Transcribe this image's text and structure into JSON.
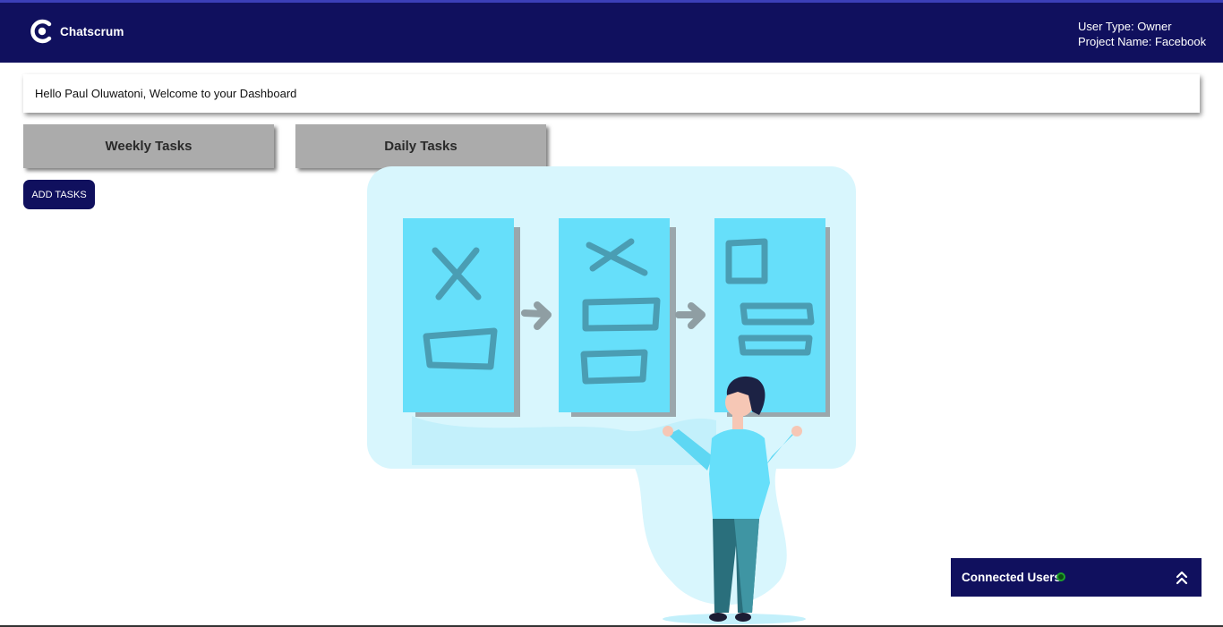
{
  "brand": {
    "name": "Chatscrum",
    "icon": "chatscrum-logo-icon"
  },
  "header": {
    "user_type": "User Type: Owner",
    "project_name": "Project Name: Facebook"
  },
  "welcome": {
    "message": "Hello Paul Oluwatoni, Welcome to your Dashboard"
  },
  "tabs": [
    {
      "label": "Weekly Tasks"
    },
    {
      "label": "Daily Tasks"
    }
  ],
  "actions": {
    "add_tasks_label": "ADD TASKS"
  },
  "connected_users": {
    "label": "Connected Users",
    "status_icon": "online-dot-icon",
    "toggle_icon": "double-chevron-up-icon"
  },
  "colors": {
    "navbar": "#10105e",
    "tab_bg": "#ababab",
    "online": "#1fa32c",
    "illustration_card": "#66dffa",
    "illustration_bg": "#d8f6fd"
  }
}
